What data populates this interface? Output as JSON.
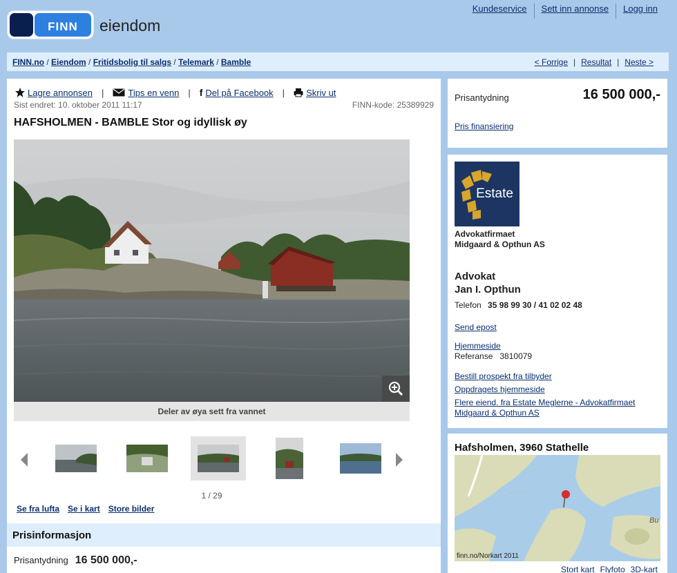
{
  "header": {
    "logo_text": "FINN",
    "section": "eiendom",
    "links": [
      "Kundeservice",
      "Sett inn annonse",
      "Logg inn"
    ]
  },
  "breadcrumb": {
    "items": [
      "FINN.no",
      "Eiendom",
      "Fritidsbolig til salgs",
      "Telemark",
      "Bamble"
    ],
    "nav": [
      "< Forrige",
      "Resultat",
      "Neste >"
    ]
  },
  "ad": {
    "actions": {
      "save": "Lagre annonsen",
      "tip": "Tips en venn",
      "facebook": "Del på Facebook",
      "print": "Skriv ut"
    },
    "last_changed": "Sist endret: 10. oktober 2011 11:17",
    "finn_code": "FINN-kode: 25389929",
    "title": "HAFSHOLMEN - BAMBLE Stor og idyllisk øy",
    "image_caption": "Deler av øya sett fra vannet",
    "image_counter": "1 / 29",
    "image_links": [
      "Se fra lufta",
      "Se i kart",
      "Store bilder"
    ],
    "price_section_title": "Prisinformasjon",
    "price_label": "Prisantydning",
    "price_value": "16 500 000,-"
  },
  "price_box": {
    "label": "Prisantydning",
    "value": "16 500 000,-",
    "financing_link": "Pris finansiering"
  },
  "broker": {
    "logo_text": "Estate",
    "firm": "Advokatfirmaet",
    "firm_line2": "Midgaard & Opthun AS",
    "role": "Advokat",
    "name": "Jan I. Opthun",
    "phone_label": "Telefon",
    "phone_numbers": "35 98 99 30 / 41 02 02 48",
    "send_email": "Send epost",
    "homepage": "Hjemmeside",
    "reference_label": "Referanse",
    "reference_value": "3810079",
    "order_prospect": "Bestill prospekt fra tilbyder",
    "assignment_homepage": "Oppdragets hjemmeside",
    "more_props": "Flere eiend. fra Estate Meglerne - Advokatfirmaet",
    "more_props_line2": "Midgaard & Opthun AS"
  },
  "map": {
    "title": "Hafsholmen, 3960 Stathelle",
    "credit": "finn.no/Norkart 2011",
    "place_label": "Bu",
    "links": [
      "Stort kart",
      "Flyfoto",
      "3D-kart"
    ]
  },
  "colors": {
    "background": "#a9c9ea",
    "link": "#0a2f6e",
    "section_band": "#dfeefc",
    "logo_navy": "#0b1f4f",
    "logo_blue": "#2d7fe0",
    "estate_gold": "#d7a62c"
  }
}
